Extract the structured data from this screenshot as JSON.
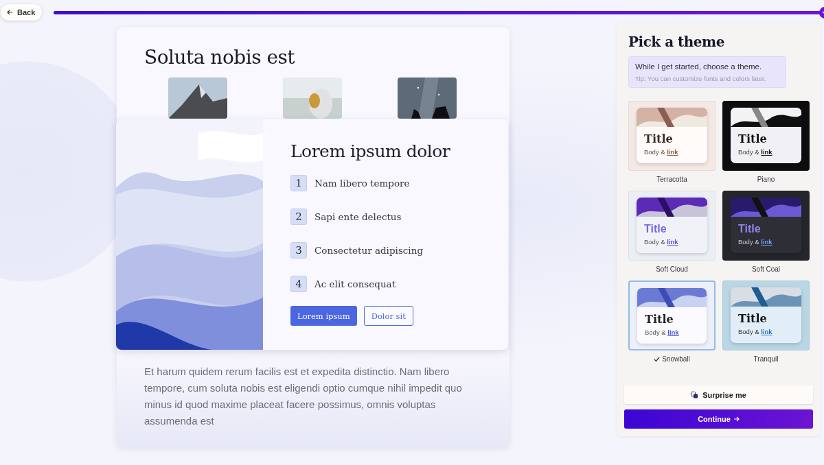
{
  "back_button": {
    "label": "Back"
  },
  "progress": {
    "level": 1
  },
  "preview": {
    "back_card": {
      "title": "Soluta nobis est",
      "paragraph": "Et harum quidem rerum facilis est et expedita distinctio. Nam libero tempore, cum soluta nobis est eligendi optio cumque nihil impedit quo minus id quod maxime placeat facere possimus, omnis voluptas assumenda est"
    },
    "front_card": {
      "title": "Lorem ipsum dolor",
      "steps": [
        {
          "number": "1",
          "text": "Nam libero tempore"
        },
        {
          "number": "2",
          "text": "Sapi ente delectus"
        },
        {
          "number": "3",
          "text": "Consectetur adipiscing"
        },
        {
          "number": "4",
          "text": "Ac elit consequat"
        }
      ],
      "buttons": [
        {
          "label": "Lorem ipsum",
          "kind": "primary"
        },
        {
          "label": "Dolor sit",
          "kind": "secondary"
        }
      ]
    }
  },
  "theme_panel": {
    "title": "Pick a theme",
    "tip": {
      "message": "While I get started, choose a theme.",
      "hint": "Tip: You can customize fonts and colors later."
    },
    "themes": [
      {
        "name": "Terracotta",
        "kind": "terracotta",
        "selected": false,
        "title": "Title",
        "body": "Body &",
        "link": "link"
      },
      {
        "name": "Piano",
        "kind": "piano",
        "selected": false,
        "title": "Title",
        "body": "Body &",
        "link": "link"
      },
      {
        "name": "Soft Cloud",
        "kind": "cloud",
        "selected": false,
        "title": "Title",
        "body": "Body &",
        "link": "link"
      },
      {
        "name": "Soft Coal",
        "kind": "coal",
        "selected": false,
        "title": "Title",
        "body": "Body &",
        "link": "link"
      },
      {
        "name": "Snowball",
        "kind": "snowball",
        "selected": true,
        "title": "Title",
        "body": "Body &",
        "link": "link"
      },
      {
        "name": "Tranquil",
        "kind": "tranquil",
        "selected": false,
        "title": "Title",
        "body": "Body &",
        "link": "link"
      }
    ],
    "surprise_button": {
      "label": "Surprise me"
    },
    "continue_button": {
      "label": "Continue"
    }
  }
}
